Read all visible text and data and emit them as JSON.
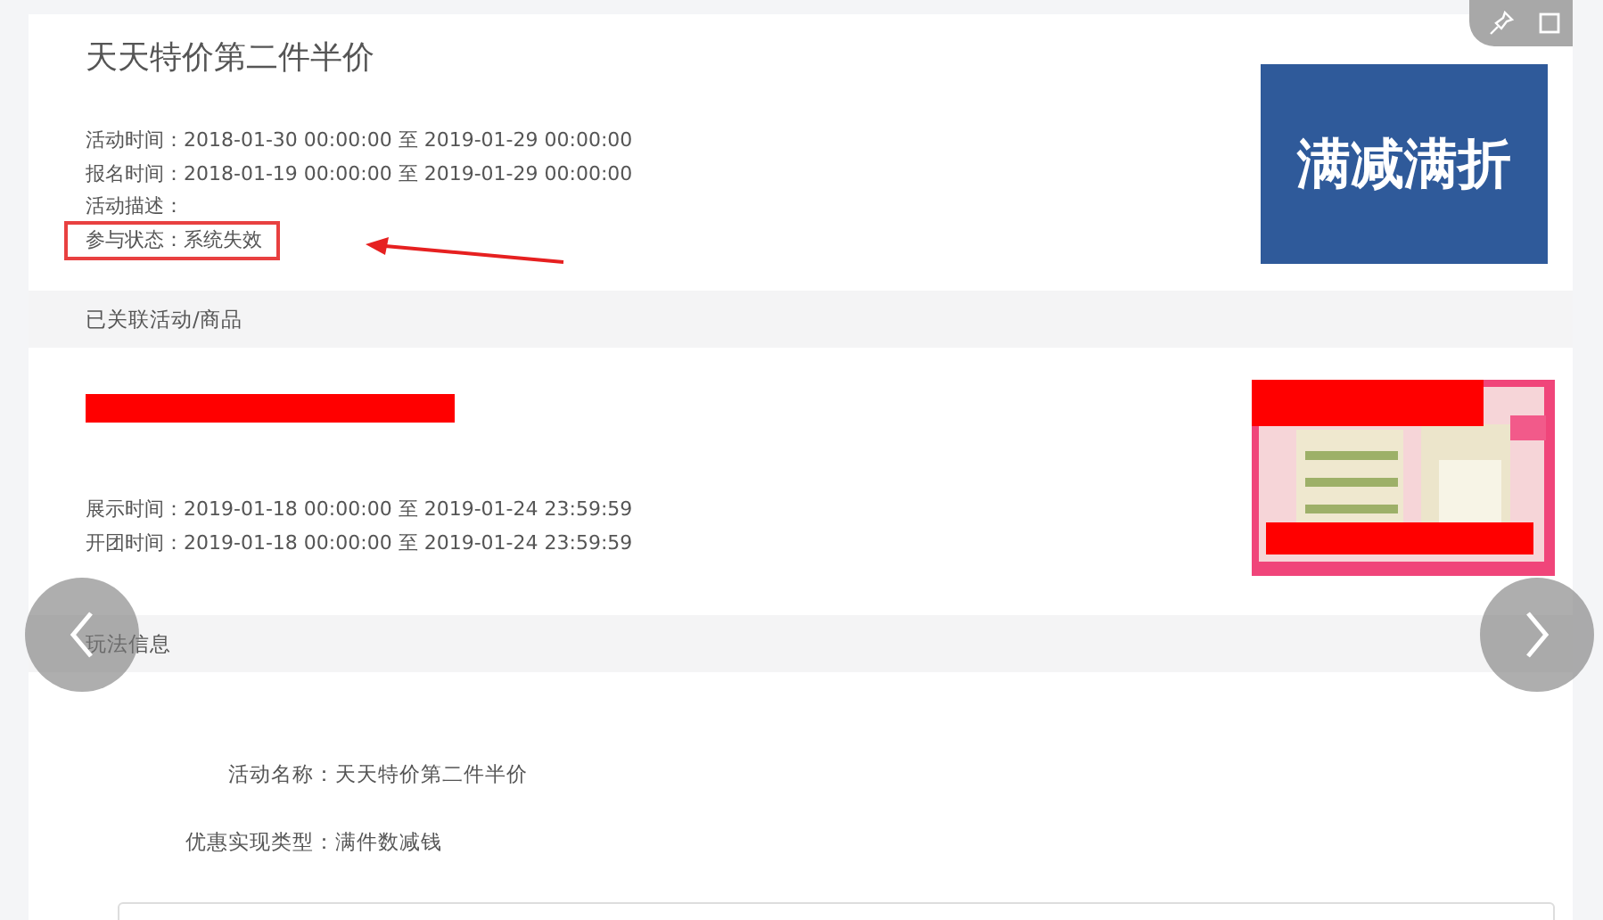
{
  "activity": {
    "title": "天天特价第二件半价",
    "fields": [
      {
        "label": "活动时间：",
        "value": "2018-01-30 00:00:00 至 2019-01-29 00:00:00",
        "highlighted": false
      },
      {
        "label": "报名时间：",
        "value": "2018-01-19 00:00:00 至 2019-01-29 00:00:00",
        "highlighted": false
      },
      {
        "label": "活动描述：",
        "highlighted": false
      },
      {
        "label": "参与状态：",
        "value": "系统失效",
        "highlighted": true
      }
    ],
    "banner": "满减满折"
  },
  "linked_section": {
    "title": "已关联活动/商品"
  },
  "product": {
    "fields": [
      {
        "label": "展示时间：",
        "value": "2019-01-18 00:00:00 至 2019-01-24 23:59:59"
      },
      {
        "label": "开团时间：",
        "value": "2019-01-18 00:00:00 至 2019-01-24 23:59:59"
      }
    ]
  },
  "play_section": {
    "title": "玩法信息",
    "fields": [
      {
        "label": "活动名称：",
        "value": "天天特价第二件半价"
      },
      {
        "label": "优惠实现类型：",
        "value": "满件数减钱"
      }
    ]
  }
}
